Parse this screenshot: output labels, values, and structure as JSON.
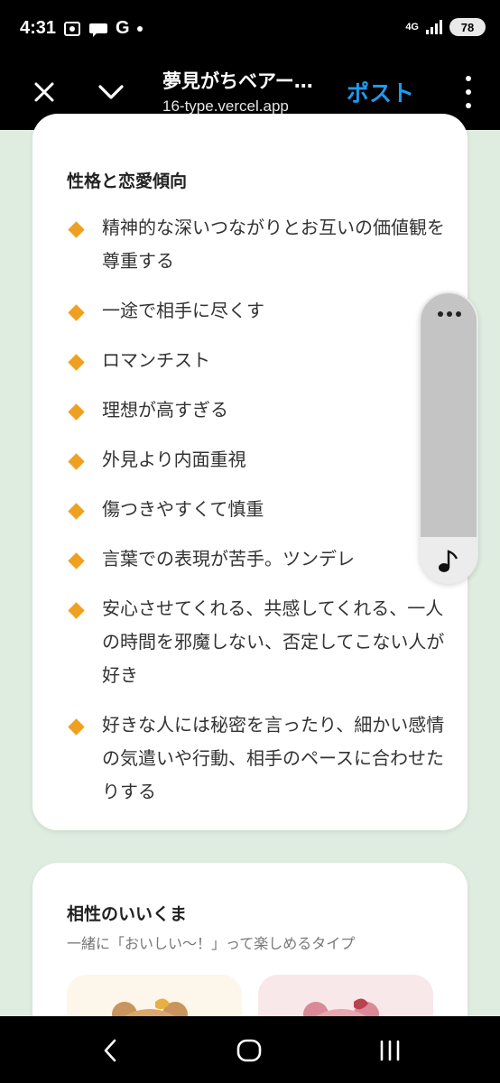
{
  "status_bar": {
    "time": "4:31",
    "g_label": "G",
    "network": "4G",
    "battery": "78"
  },
  "app_bar": {
    "title": "夢見がちベアー…",
    "url": "16-type.vercel.app",
    "post_label": "ポスト"
  },
  "card1": {
    "title": "性格と恋愛傾向",
    "items": [
      "精神的な深いつながりとお互いの価値観を尊重する",
      "一途で相手に尽くす",
      "ロマンチスト",
      "理想が高すぎる",
      "外見より内面重視",
      "傷つきやすくて慎重",
      "言葉での表現が苦手。ツンデレ",
      "安心させてくれる、共感してくれる、一人の時間を邪魔しない、否定してこない人が好き",
      "好きな人には秘密を言ったり、細かい感情の気遣いや行動、相手のペースに合わせたりする"
    ]
  },
  "card2": {
    "title": "相性のいいくま",
    "subtitle": "一緒に「おいしい〜！」って楽しめるタイプ"
  },
  "colors": {
    "bullet": "#f0a020",
    "post": "#1d9bf0",
    "background": "#dfece0"
  }
}
